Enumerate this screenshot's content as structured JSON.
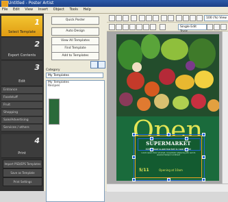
{
  "app": {
    "title": "Untitled - Poster Artist"
  },
  "menu": [
    "File",
    "Edit",
    "View",
    "Insert",
    "Object",
    "Tools",
    "Help"
  ],
  "steps": [
    {
      "num": "1",
      "label": "Select Template"
    },
    {
      "num": "2",
      "label": "Export Contents"
    },
    {
      "num": "3",
      "label": "Edit"
    },
    {
      "num": "4",
      "label": "Print"
    }
  ],
  "edit_items": [
    "Entrance",
    "Foodstuff",
    "Fruit",
    "Shopping",
    "Sale/Advertising",
    "Services / others"
  ],
  "bottom_buttons": [
    "Import PSD/EPS Templates",
    "Save as Template",
    "Print Settings"
  ],
  "mid_buttons": [
    "Quick Poster",
    "Auto Design",
    "View All Templates",
    "Find Template",
    "Add to Templates"
  ],
  "category_label": "Category",
  "category_value": "My Templates",
  "template_list": [
    "My Templates",
    "Recipes"
  ],
  "zoom": "100 (%) View",
  "font_field": "Single Edit Tools",
  "poster": {
    "headline": "Open",
    "store": "SUPERMARKET",
    "subtitle": "XXXX food supermarket is now open!",
    "body": "Lorem ipsum dolor sit amet, consectetur adipiscing elit, sed do eiusmod tempor incididunt",
    "date": "5/11",
    "time": "Opening at 10am"
  },
  "colors": {
    "accent": "#f2c531",
    "poster_bg": "#1a6b3c",
    "headline": "#e4e655",
    "selection": "#1e63d6"
  }
}
